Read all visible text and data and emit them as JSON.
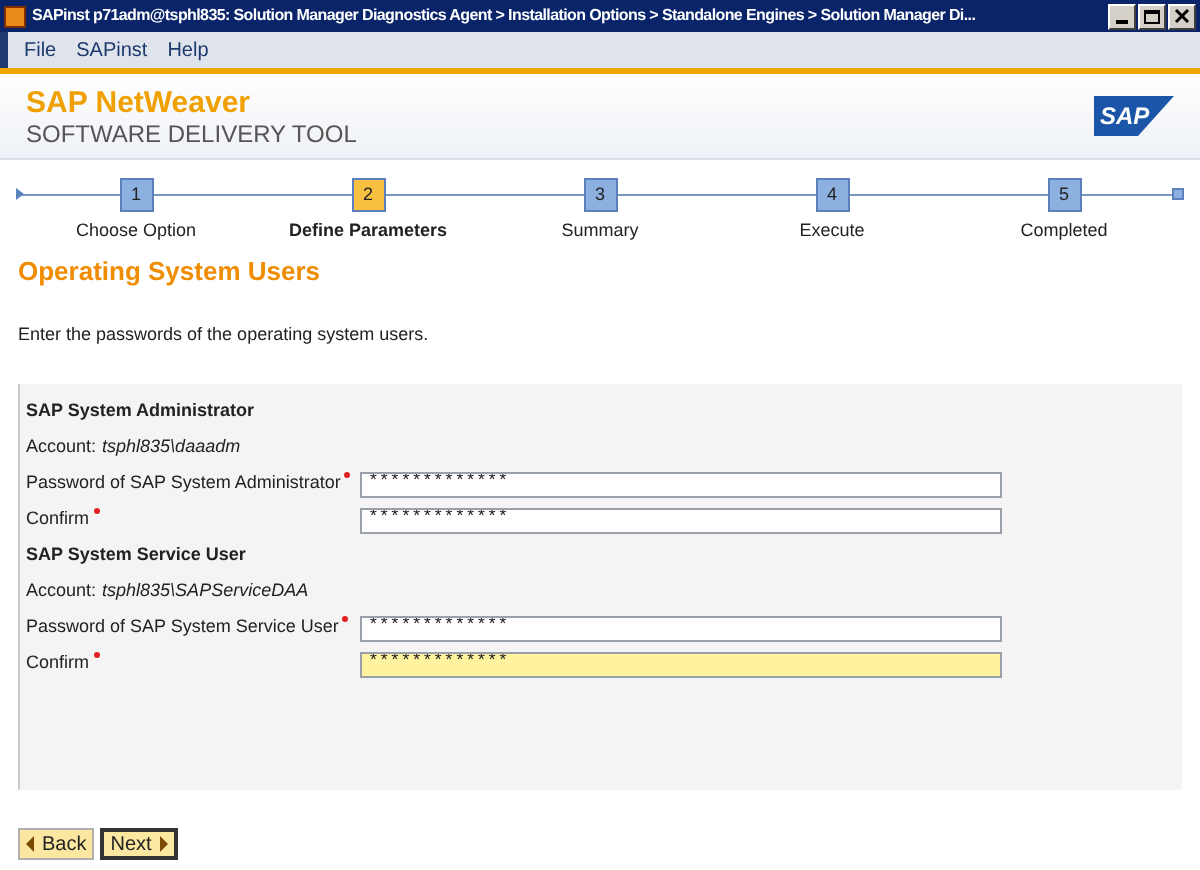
{
  "window": {
    "title": "SAPinst p71adm@tsphl835: Solution Manager Diagnostics Agent > Installation Options > Standalone Engines > Solution Manager Di..."
  },
  "menu": [
    "File",
    "SAPinst",
    "Help"
  ],
  "header": {
    "product": "SAP NetWeaver",
    "subtitle": "SOFTWARE DELIVERY TOOL",
    "logo": "SAP"
  },
  "steps": [
    {
      "number": "1",
      "label": "Choose Option",
      "selected": false
    },
    {
      "number": "2",
      "label": "Define Parameters",
      "selected": true
    },
    {
      "number": "3",
      "label": "Summary",
      "selected": false
    },
    {
      "number": "4",
      "label": "Execute",
      "selected": false
    },
    {
      "number": "5",
      "label": "Completed",
      "selected": false
    }
  ],
  "heading": "Operating System Users",
  "intro": "Enter the passwords of the operating system users.",
  "sections": [
    {
      "title": "SAP System Administrator",
      "account_label": "Account:",
      "account": "tsphl835\\daaadm",
      "fields": [
        {
          "label": "Password of SAP System Administrator",
          "required": true,
          "value": "*************",
          "focused": false
        },
        {
          "label": "Confirm",
          "required": true,
          "value": "*************",
          "focused": false
        }
      ]
    },
    {
      "title": "SAP System Service User",
      "account_label": "Account:",
      "account": "tsphl835\\SAPServiceDAA",
      "fields": [
        {
          "label": "Password of SAP System Service User",
          "required": true,
          "value": "*************",
          "focused": false
        },
        {
          "label": "Confirm",
          "required": true,
          "value": "*************",
          "focused": true
        }
      ]
    }
  ],
  "buttons": [
    {
      "label": "Back",
      "kind": "back"
    },
    {
      "label": "Next",
      "kind": "next"
    }
  ]
}
